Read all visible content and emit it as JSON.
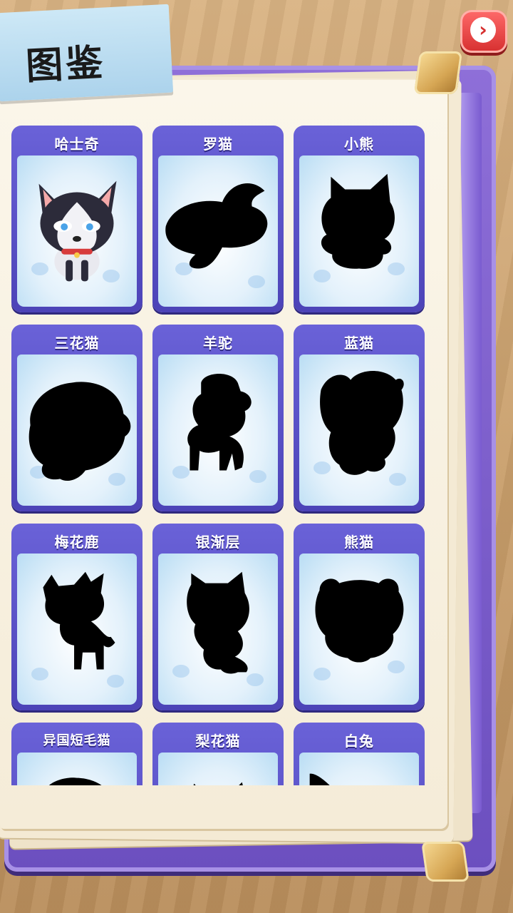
{
  "header": {
    "title": "图鉴",
    "next_button_icon": "chevron-right-icon"
  },
  "colors": {
    "card_border": "#5a52c8",
    "card_panel": "#cfe7f8",
    "next_button": "#e63e3e",
    "book_cover": "#7a5bd0"
  },
  "cards": [
    {
      "name": "哈士奇",
      "unlocked": true
    },
    {
      "name": "罗猫",
      "unlocked": false
    },
    {
      "name": "小熊",
      "unlocked": false
    },
    {
      "name": "三花猫",
      "unlocked": false
    },
    {
      "name": "羊驼",
      "unlocked": false
    },
    {
      "name": "蓝猫",
      "unlocked": false
    },
    {
      "name": "梅花鹿",
      "unlocked": false
    },
    {
      "name": "银渐层",
      "unlocked": false
    },
    {
      "name": "熊猫",
      "unlocked": false
    },
    {
      "name": "异国短毛猫",
      "unlocked": false
    },
    {
      "name": "梨花猫",
      "unlocked": false
    },
    {
      "name": "白兔",
      "unlocked": false
    }
  ]
}
